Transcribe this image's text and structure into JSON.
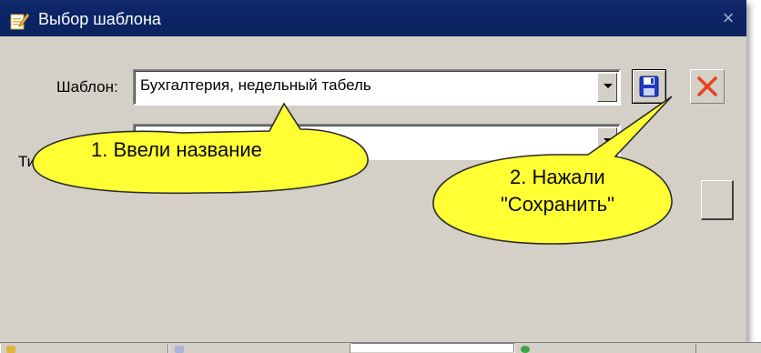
{
  "window": {
    "title": "Выбор шаблона",
    "close_glyph": "×"
  },
  "form": {
    "template_label": "Шаблон:",
    "template_value": "Бухгалтерия, недельный табель",
    "type_label": "Тип"
  },
  "toolbar": {
    "save_icon": "floppy-disk-icon",
    "cancel_icon": "red-x-icon"
  },
  "callouts": {
    "first_text": "1. Ввели название",
    "second_line1": "2. Нажали",
    "second_line2": "\"Сохранить\""
  },
  "colors": {
    "titlebar": "#0a246a",
    "window_bg": "#d4d0c8",
    "callout_fill": "#ffff33",
    "cancel_red": "#e8431f",
    "save_blue": "#1f3cc4"
  }
}
